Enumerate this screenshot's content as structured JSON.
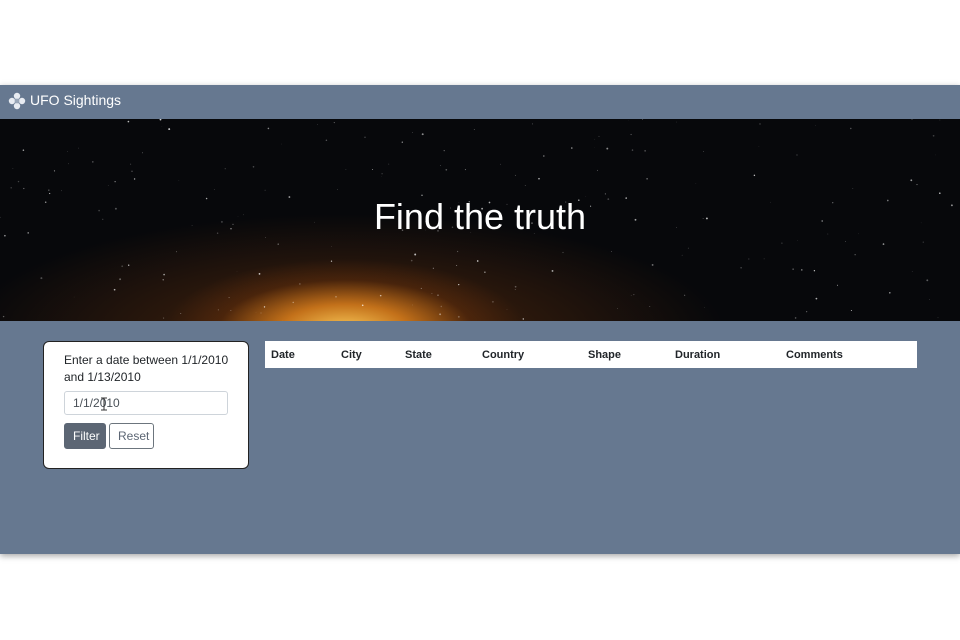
{
  "navbar": {
    "title": "UFO Sightings",
    "icon": "ufo-icon"
  },
  "hero": {
    "title": "Find the truth"
  },
  "filter": {
    "label": "Enter a date between 1/1/2010 and 1/13/2010",
    "input_value": "1/1/2010",
    "filter_button": "Filter",
    "reset_button": "Reset"
  },
  "table": {
    "columns": [
      "Date",
      "City",
      "State",
      "Country",
      "Shape",
      "Duration",
      "Comments"
    ],
    "rows": []
  },
  "colors": {
    "navbar": "#667890",
    "page": "#667890",
    "button_primary": "#5c6674"
  }
}
